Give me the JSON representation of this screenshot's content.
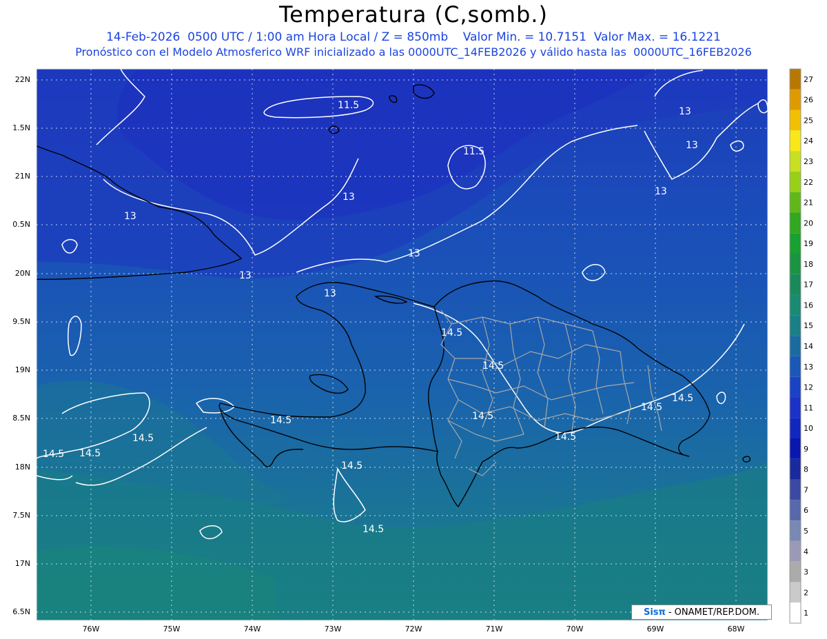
{
  "header": {
    "title": "Temperatura (C,somb.)",
    "subtitle_line1": "14-Feb-2026  0500 UTC / 1:00 am Hora Local / Z = 850mb    Valor Min. = 10.7151  Valor Max. = 16.1221",
    "subtitle_line2": "Pronóstico con el Modelo Atmosferico WRF inicializado a las 0000UTC_14FEB2026 y válido hasta las  0000UTC_16FEB2026"
  },
  "axes": {
    "lat_labels": [
      "22N",
      "1.5N",
      "21N",
      "0.5N",
      "20N",
      "9.5N",
      "19N",
      "8.5N",
      "18N",
      "7.5N",
      "17N",
      "6.5N"
    ],
    "lon_labels": [
      "76W",
      "75W",
      "74W",
      "73W",
      "72W",
      "71W",
      "70W",
      "69W",
      "68W"
    ],
    "grid": true
  },
  "colorbar": {
    "labels": [
      "27",
      "26",
      "25",
      "24",
      "23",
      "22",
      "21",
      "20",
      "19",
      "18",
      "17",
      "16",
      "15",
      "14",
      "13",
      "12",
      "11",
      "10",
      "9",
      "8",
      "7",
      "6",
      "5",
      "4",
      "3",
      "2",
      "1"
    ],
    "colors": [
      "#b87800",
      "#e09a00",
      "#f2c000",
      "#f8e818",
      "#c8e020",
      "#98d018",
      "#60b818",
      "#30a820",
      "#18a030",
      "#1a9440",
      "#1a8a5a",
      "#1a8a72",
      "#1a8088",
      "#1a6ca0",
      "#1a58b8",
      "#1a42c4",
      "#1a32c8",
      "#1028c0",
      "#0a18b0",
      "#1a2a9c",
      "#3a4aa4",
      "#5868ac",
      "#7a88b4",
      "#9a9ab8",
      "#ababab",
      "#cacaca",
      "#ffffff"
    ]
  },
  "contour_labels": [
    "11.5",
    "11.5",
    "13",
    "13",
    "13",
    "13",
    "13",
    "13",
    "13",
    "13",
    "14.5",
    "14.5",
    "14.5",
    "14.5",
    "14.5",
    "14.5",
    "14.5",
    "14.5",
    "14.5",
    "14.5",
    "14.5",
    "14.5"
  ],
  "credit": {
    "brand": "Sisπ",
    "text": "- ONAMET/REP.DOM."
  },
  "colors": {
    "sea_cool": "#1b3fbe",
    "sea_mid": "#1a58b8",
    "sea_warm": "#1a7f8c",
    "contour": "#ffffff",
    "coast": "#000000",
    "provinces": "#a0a0a0",
    "text_blue": "#1a44e0"
  }
}
